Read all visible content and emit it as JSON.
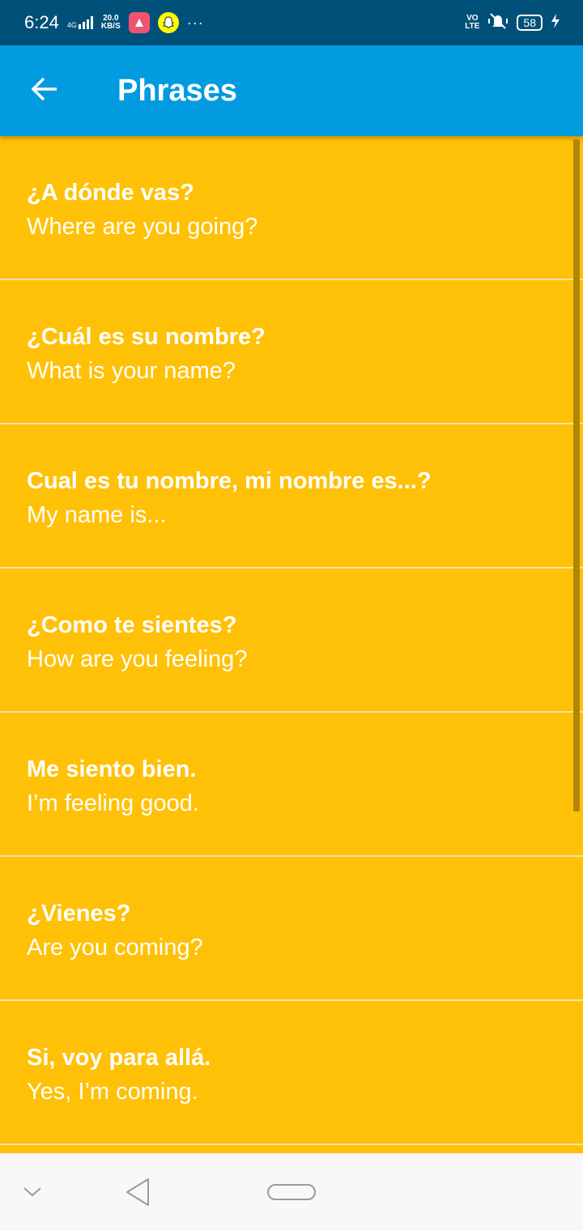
{
  "status_bar": {
    "time": "6:24",
    "network": "4G",
    "speed_value": "20.0",
    "speed_unit": "KB/S",
    "more": "···",
    "volte_top": "VO",
    "volte_bottom": "LTE",
    "battery": "58",
    "icons": [
      "signal-icon",
      "app-notification-icon",
      "snapchat-icon",
      "vibrate-icon",
      "charging-icon"
    ]
  },
  "app_bar": {
    "title": "Phrases",
    "back_icon": "arrow-left-icon",
    "color": "#039BDF"
  },
  "theme": {
    "list_background": "#FFC107",
    "status_bar": "#01507A"
  },
  "phrases": [
    {
      "spanish": "¿A dónde vas?",
      "english": "Where are you going?"
    },
    {
      "spanish": "¿Cuál es su nombre?",
      "english": "What is your name?"
    },
    {
      "spanish": "Cual es tu nombre, mi nombre es...?",
      "english": "My name is..."
    },
    {
      "spanish": "¿Como te sientes?",
      "english": "How are you feeling?"
    },
    {
      "spanish": "Me siento bien.",
      "english": "I’m feeling good."
    },
    {
      "spanish": "¿Vienes?",
      "english": "Are you coming?"
    },
    {
      "spanish": "Si, voy para allá.",
      "english": "Yes, I’m coming."
    }
  ],
  "nav_bar": {
    "icons": [
      "chevron-down-icon",
      "back-triangle-icon",
      "home-pill-icon"
    ]
  }
}
